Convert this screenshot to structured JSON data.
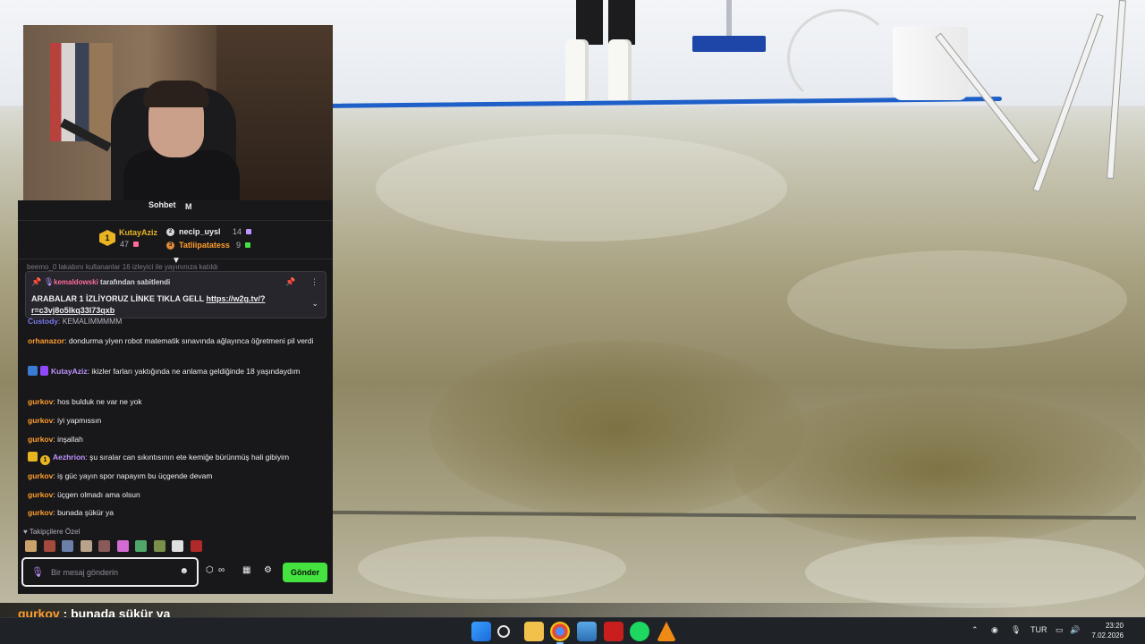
{
  "chat": {
    "title": "Sohbet",
    "title_extra": "M",
    "leaderboard": {
      "first": {
        "rank": "1",
        "name": "KutayAziz",
        "count": "47"
      },
      "second": {
        "name": "necip_uysl",
        "count": "14"
      },
      "third": {
        "name": "Tatliipatatess",
        "count": "9"
      }
    },
    "ghost_row": "beemo_0 lakabını kullananlar 16 izleyici ile yayınınıza katıldı",
    "pinned": {
      "pinned_by_user": "kemaldowski",
      "pinned_by_text": "tarafından sabitlendi",
      "message_text": "ARABALAR 1 İZLİYORUZ LİNKE TIKLA GELL ",
      "link": "https://w2g.tv/?r=c3vj8o5lkq33l73qxb"
    },
    "partial_message": {
      "user": "Custody",
      "text": ": KEMALIMMMMM"
    },
    "messages": [
      {
        "user": "orhanazor",
        "text": ": dondurma yiyen robot matematik sınavında ağlayınca öğretmeni pil verdi"
      },
      {
        "user": "KutayAziz",
        "text": ": ikizler farları yaktığında ne anlama geldiğinde 18 yaşındaydım"
      },
      {
        "user": "gurkov",
        "text": ": hos bulduk ne var ne yok"
      },
      {
        "user": "gurkov",
        "text": ": iyi yapmıssın"
      },
      {
        "user": "gurkov",
        "text": ": inşallah"
      },
      {
        "user": "Aezhrion",
        "badge_rank": "1",
        "text": ": şu sıralar can sıkıntısının ete kemiğe bürünmüş hali gibiyim"
      },
      {
        "user": "gurkov",
        "text": ": iş güc yayın spor napayım bu üçgende devam"
      },
      {
        "user": "gurkov",
        "text": ": üçgen olmadı ama olsun"
      },
      {
        "user": "gurkov",
        "text": ": bunada şükür ya"
      }
    ],
    "followers_label": "♥ Takipçilere Özel",
    "composer": {
      "placeholder": "Bir mesaj gönderin"
    },
    "send_label": "Gönder"
  },
  "overlay": {
    "user": "gurkov",
    "text": " : bunada şükür ya"
  },
  "taskbar": {
    "language": "TUR",
    "time": "23:20",
    "date": "7.02.2026"
  },
  "colors": {
    "gold": "#e8b422",
    "pink_user": "#ff6b9a",
    "orange_user": "#ff9e2c",
    "purple_user": "#bf94ff",
    "send_green": "#45e33f",
    "chat_bg": "#18181b"
  }
}
